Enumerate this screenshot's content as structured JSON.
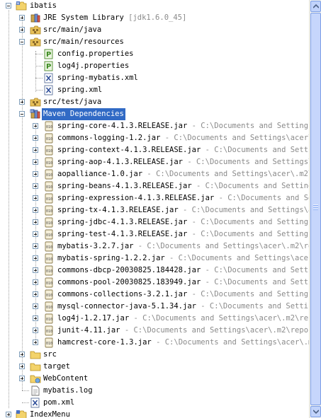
{
  "tree": {
    "project": "ibatis",
    "jre_library": "JRE System Library",
    "jre_decoration": "[jdk1.6.0_45]",
    "src_main_java": "src/main/java",
    "src_main_resources": "src/main/resources",
    "resources": [
      {
        "name": "config.properties",
        "type": "properties"
      },
      {
        "name": "log4j.properties",
        "type": "properties"
      },
      {
        "name": "spring-mybatis.xml",
        "type": "xml"
      },
      {
        "name": "spring.xml",
        "type": "xml"
      }
    ],
    "src_test_java": "src/test/java",
    "maven_dependencies": "Maven Dependencies",
    "jars": [
      {
        "name": "spring-core-4.1.3.RELEASE.jar",
        "path": " - C:\\Documents and Settings\\a"
      },
      {
        "name": "commons-logging-1.2.jar",
        "path": " - C:\\Documents and Settings\\acer\\.m2"
      },
      {
        "name": "spring-context-4.1.3.RELEASE.jar",
        "path": " - C:\\Documents and Setting"
      },
      {
        "name": "spring-aop-4.1.3.RELEASE.jar",
        "path": " - C:\\Documents and Settings\\ac"
      },
      {
        "name": "aopalliance-1.0.jar",
        "path": " - C:\\Documents and Settings\\acer\\.m2\\re"
      },
      {
        "name": "spring-beans-4.1.3.RELEASE.jar",
        "path": " - C:\\Documents and Settings\\a"
      },
      {
        "name": "spring-expression-4.1.3.RELEASE.jar",
        "path": " - C:\\Documents and Sett"
      },
      {
        "name": "spring-tx-4.1.3.RELEASE.jar",
        "path": " - C:\\Documents and Settings\\ace"
      },
      {
        "name": "spring-jdbc-4.1.3.RELEASE.jar",
        "path": " - C:\\Documents and Settings\\a"
      },
      {
        "name": "spring-test-4.1.3.RELEASE.jar",
        "path": " - C:\\Documents and Settings\\a"
      },
      {
        "name": "mybatis-3.2.7.jar",
        "path": " - C:\\Documents and Settings\\acer\\.m2\\repo"
      },
      {
        "name": "mybatis-spring-1.2.2.jar",
        "path": " - C:\\Documents and Settings\\acer\\."
      },
      {
        "name": "commons-dbcp-20030825.184428.jar",
        "path": " - C:\\Documents and Setting"
      },
      {
        "name": "commons-pool-20030825.183949.jar",
        "path": " - C:\\Documents and Setting"
      },
      {
        "name": "commons-collections-3.2.1.jar",
        "path": " - C:\\Documents and Settings\\a"
      },
      {
        "name": "mysql-connector-java-5.1.34.jar",
        "path": " - C:\\Documents and Settings"
      },
      {
        "name": "log4j-1.2.17.jar",
        "path": " - C:\\Documents and Settings\\acer\\.m2\\repos"
      },
      {
        "name": "junit-4.11.jar",
        "path": " - C:\\Documents and Settings\\acer\\.m2\\reposit"
      },
      {
        "name": "hamcrest-core-1.3.jar",
        "path": " - C:\\Documents and Settings\\acer\\.m2\\"
      }
    ],
    "src": "src",
    "target": "target",
    "webcontent": "WebContent",
    "mybatis_log": "mybatis.log",
    "pom": "pom.xml",
    "index_menu": "IndexMenu"
  },
  "colors": {
    "selection": "#316ac5",
    "decoration": "#8a8a8a",
    "folder": "#f3d36b",
    "package_folder": "#e8c15a"
  }
}
